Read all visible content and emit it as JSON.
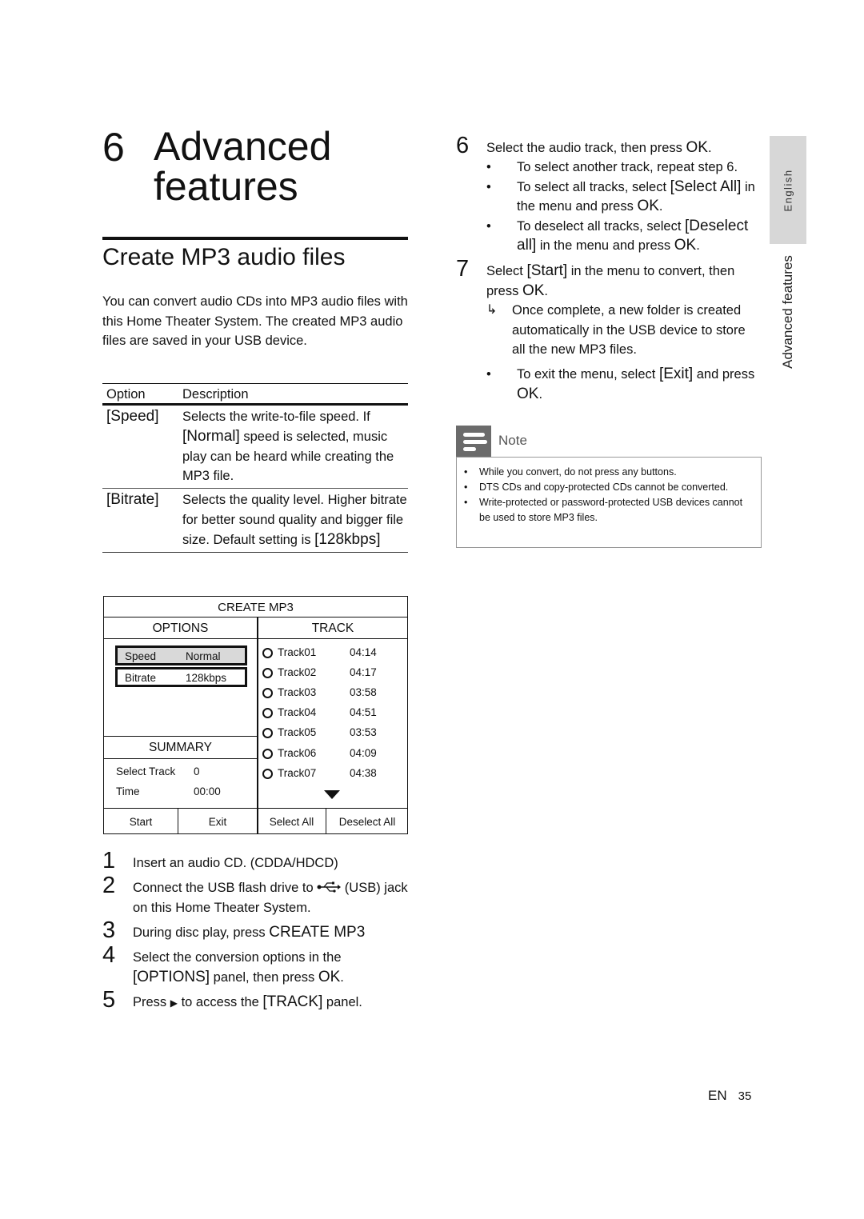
{
  "chapter": {
    "number": "6",
    "title": "Advanced features"
  },
  "section": {
    "title": "Create MP3 audio files"
  },
  "intro": "You can convert audio CDs into MP3 audio files with this Home Theater System. The created MP3 audio files are saved in your USB device.",
  "options_table": {
    "headers": [
      "Option",
      "Description"
    ],
    "rows": [
      {
        "option": "[Speed]",
        "desc_pre": "Selects the write-to-file speed. If ",
        "desc_em": "[Normal]",
        "desc_post": " speed is selected, music play can be heard while creating the MP3 file."
      },
      {
        "option": "[Bitrate]",
        "desc_pre": "Selects the quality level. Higher bitrate for better sound quality and bigger file size. Default setting is ",
        "desc_em": "[128kbps]",
        "desc_post": ""
      }
    ]
  },
  "screen": {
    "title": "CREATE MP3",
    "options_header": "OPTIONS",
    "track_header": "TRACK",
    "options": [
      {
        "label": "Speed",
        "value": "Normal",
        "selected": true
      },
      {
        "label": "Bitrate",
        "value": "128kbps",
        "selected": false
      }
    ],
    "summary_header": "SUMMARY",
    "summary": [
      {
        "label": "Select Track",
        "value": "0"
      },
      {
        "label": "Time",
        "value": "00:00"
      }
    ],
    "tracks": [
      {
        "name": "Track01",
        "duration": "04:14"
      },
      {
        "name": "Track02",
        "duration": "04:17"
      },
      {
        "name": "Track03",
        "duration": "03:58"
      },
      {
        "name": "Track04",
        "duration": "04:51"
      },
      {
        "name": "Track05",
        "duration": "03:53"
      },
      {
        "name": "Track06",
        "duration": "04:09"
      },
      {
        "name": "Track07",
        "duration": "04:38"
      }
    ],
    "buttons": [
      "Start",
      "Exit",
      "Select All",
      "Deselect All"
    ]
  },
  "steps_left": [
    {
      "n": "1",
      "pre": "Insert an audio CD. (CDDA/HDCD)",
      "em": "",
      "post": ""
    },
    {
      "n": "2",
      "pre": "Connect the USB flash drive to ",
      "icon": "usb-icon",
      "post": " (USB) jack on this Home Theater System."
    },
    {
      "n": "3",
      "pre": "During disc play, press ",
      "em": "CREATE MP3",
      "post": ""
    },
    {
      "n": "4",
      "pre": "Select the conversion options in the ",
      "em": "[OPTIONS]",
      "post": " panel, then press ",
      "em2": "OK",
      "post2": "."
    },
    {
      "n": "5",
      "pre": "Press ",
      "icon": "play-right-icon",
      "post": " to access the ",
      "em": "[TRACK]",
      "post2": " panel."
    }
  ],
  "steps_right": [
    {
      "n": "6",
      "pre": "Select the audio track, then press ",
      "em": "OK",
      "post": ".",
      "bullets": [
        {
          "pre": "To select another track, repeat step 6.",
          "em": "",
          "post": ""
        },
        {
          "pre": "To select all tracks, select ",
          "em": "[Select All]",
          "post": " in the menu and press ",
          "em2": "OK",
          "post2": "."
        },
        {
          "pre": "To deselect all tracks, select ",
          "em": "[Deselect all]",
          "post": " in the menu and press ",
          "em2": "OK",
          "post2": "."
        }
      ]
    },
    {
      "n": "7",
      "pre": "Select ",
      "em": "[Start]",
      "post": " in the menu to convert, then press ",
      "em2": "OK",
      "post2": ".",
      "result": "Once complete, a new folder is created automatically in the USB device to store all the new MP3 files.",
      "bullets": [
        {
          "pre": "To exit the menu, select ",
          "em": "[Exit]",
          "post": " and press ",
          "em2": "OK",
          "post2": "."
        }
      ]
    }
  ],
  "note": {
    "label": "Note",
    "items": [
      "While you convert, do not press any buttons.",
      "DTS CDs and copy-protected CDs cannot be converted.",
      "Write-protected or password-protected USB devices cannot be used to store MP3 files."
    ]
  },
  "side_tabs": {
    "language": "English",
    "section": "Advanced features"
  },
  "footer": {
    "lang": "EN",
    "page": "35"
  },
  "colors": {
    "tab_bg": "#d7d7d7",
    "note_icon_bg": "#6b6b6b",
    "selected_option_bg": "#d9d9d9"
  }
}
